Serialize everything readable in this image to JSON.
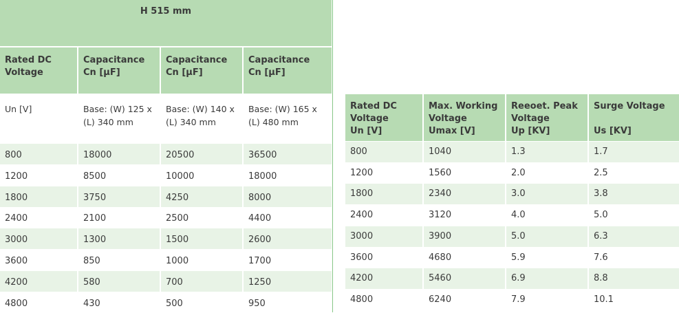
{
  "left_table": {
    "title": "H 515  mm",
    "headers": [
      "Rated  DC\nVoltage",
      "Capacitance\nCn [μF]",
      "Capacitance\nCn [μF]",
      "Capacitance\nCn [μF]"
    ],
    "base_row": [
      "Un [V]",
      "Base:  (W) 125 x (L) 340  mm",
      "Base:  (W) 140 x (L) 340  mm",
      "Base:  (W) 165 x (L) 480  mm"
    ],
    "rows": [
      [
        "800",
        "18000",
        "20500",
        "36500"
      ],
      [
        "1200",
        "8500",
        "10000",
        "18000"
      ],
      [
        "1800",
        "3750",
        "4250",
        "8000"
      ],
      [
        "2400",
        "2100",
        "2500",
        "4400"
      ],
      [
        "3000",
        "1300",
        "1500",
        "2600"
      ],
      [
        "3600",
        "850",
        "1000",
        "1700"
      ],
      [
        "4200",
        "580",
        "700",
        "1250"
      ],
      [
        "4800",
        "430",
        "500",
        "950"
      ]
    ]
  },
  "right_table": {
    "headers": [
      {
        "label": "Rated  DC Voltage",
        "unit": "Un [V]"
      },
      {
        "label": "Max. Working Voltage",
        "unit": "Umax [V]"
      },
      {
        "label": "Reeoet. Peak Voltage",
        "unit": "Up [KV]"
      },
      {
        "label": "Surge Voltage",
        "unit": "Us [KV]"
      }
    ],
    "rows": [
      [
        "800",
        "1040",
        "1.3",
        "1.7"
      ],
      [
        "1200",
        "1560",
        "2.0",
        "2.5"
      ],
      [
        "1800",
        "2340",
        "3.0",
        "3.8"
      ],
      [
        "2400",
        "3120",
        "4.0",
        "5.0"
      ],
      [
        "3000",
        "3900",
        "5.0",
        "6.3"
      ],
      [
        "3600",
        "4680",
        "5.9",
        "7.6"
      ],
      [
        "4200",
        "5460",
        "6.9",
        "8.8"
      ],
      [
        "4800",
        "6240",
        "7.9",
        "10.1"
      ]
    ]
  },
  "colors": {
    "header_green": "#b7dbb3",
    "stripe_green": "#e8f3e6",
    "border_green": "#86c686",
    "text": "#3a3a3a"
  }
}
